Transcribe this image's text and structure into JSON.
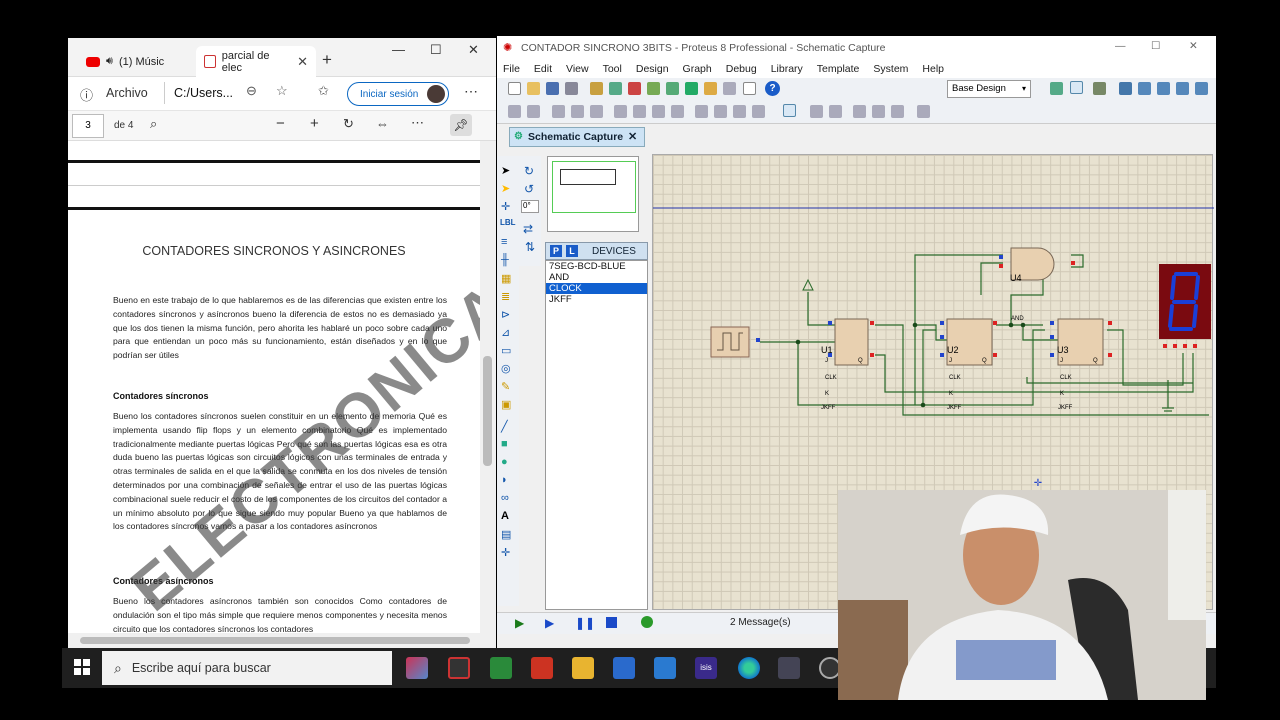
{
  "edge": {
    "tabs": [
      {
        "label": "(1) Músic",
        "icon": "youtube-icon"
      },
      {
        "label": "parcial de elec",
        "icon": "pdf-icon"
      }
    ],
    "archivo_label": "Archivo",
    "address": "C:/Users...",
    "signin_label": "Iniciar sesión",
    "pdf": {
      "page_current": "3",
      "page_total": "de 4"
    },
    "doc": {
      "title": "CONTADORES SINCRONOS Y ASINCRONES",
      "intro": "Bueno en este trabajo de lo que hablaremos es de las diferencias que existen entre los contadores síncronos y asíncronos bueno la diferencia de estos no es demasiado ya que los dos tienen la misma función, pero ahorita les hablaré un poco sobre cada uno para que entiendan un poco más su funcionamiento, están diseñados y en lo que podrían ser útiles",
      "h_sync": "Contadores síncronos",
      "p_sync": "Bueno los contadores síncronos suelen constituir en un elemento de memoria Qué es implementa usando flip flops y un elemento combinatorio Qué es implementado tradicionalmente mediante puertas lógicas Pero qué son las puertas lógicas esa es otra duda bueno las puertas lógicas son circuitos lógicos con unas terminales de entrada y otras terminales de salida en el que la salida se conmuta en los dos niveles de tensión determinados por una combinación de señales de entrar el uso de las puertas lógicas combinacional suele reducir el costo de los componentes de los circuitos del contador a un mínimo absoluto por lo que sigue siendo muy popular Bueno ya que hablamos de los contadores síncronos vamos a pasar a los contadores asíncronos",
      "h_async": "Contadores asíncronos",
      "p_async": "Bueno los contadores asíncronos también son conocidos Como contadores de ondulación son el tipo más simple que requiere menos componentes y necesita menos circuito que los contadores síncronos los contadores",
      "watermark": "ELECTRONICA"
    }
  },
  "proteus": {
    "title": "CONTADOR SINCRONO 3BITS - Proteus 8 Professional - Schematic Capture",
    "menu": [
      "File",
      "Edit",
      "View",
      "Tool",
      "Design",
      "Graph",
      "Debug",
      "Library",
      "Template",
      "System",
      "Help"
    ],
    "layer_select": "Base Design",
    "tab_label": "Schematic Capture",
    "rotation": "0°",
    "devices_label": "DEVICES",
    "devices": [
      "7SEG-BCD-BLUE",
      "AND",
      "CLOCK",
      "JKFF"
    ],
    "selected_device": "CLOCK",
    "components": {
      "u1": "U1",
      "u2": "U2",
      "u3": "U3",
      "u4": "U4",
      "ff_type": "JKFF",
      "gate_type": "AND",
      "pin_j": "J",
      "pin_k": "K",
      "pin_clk": "CLK",
      "pin_q": "Q"
    },
    "status": "2 Message(s)"
  },
  "taskbar": {
    "search_placeholder": "Escribe aquí para buscar"
  },
  "colors": {
    "edge_accent": "#0b67c2",
    "proteus_select": "#1060d0",
    "wire": "#2a6a2a",
    "seven_seg": "#1a3fd8"
  }
}
